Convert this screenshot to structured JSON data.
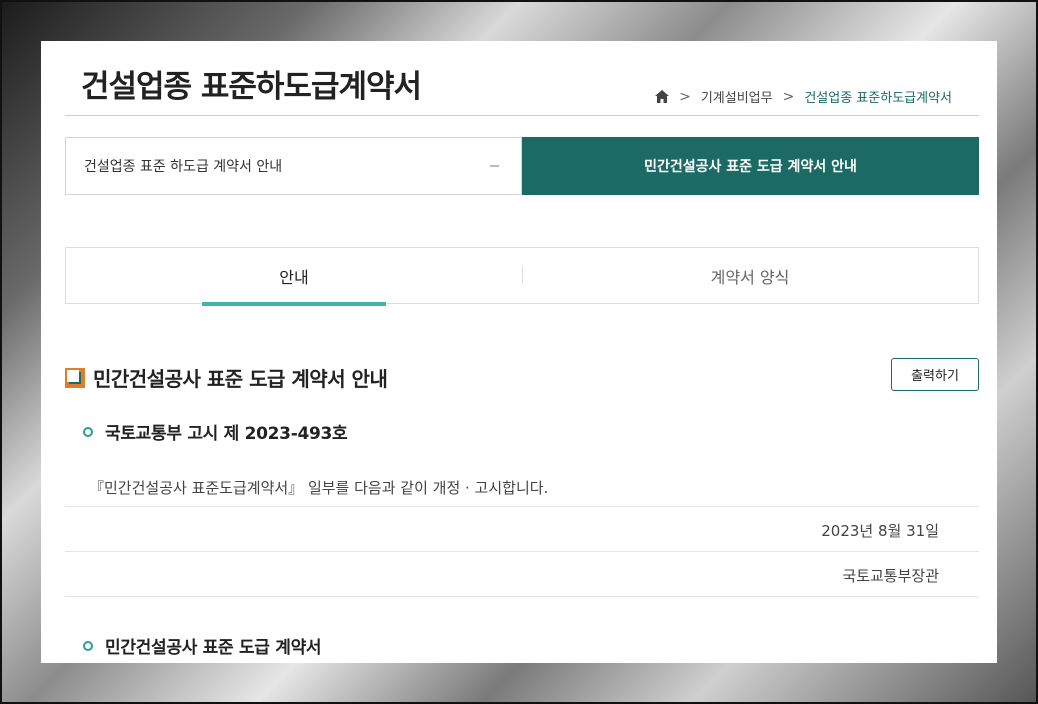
{
  "page": {
    "title": "건설업종 표준하도급계약서"
  },
  "breadcrumb": {
    "home_icon": "home-icon",
    "items": [
      "기계설비업무",
      "건설업종 표준하도급계약서"
    ]
  },
  "selector": {
    "left_label": "건설업종 표준 하도급 계약서 안내",
    "right_label": "민간건설공사 표준 도급 계약서 안내",
    "accent_color": "#1b6b64"
  },
  "tabs": [
    {
      "label": "안내",
      "active": true
    },
    {
      "label": "계약서 양식",
      "active": false
    }
  ],
  "section": {
    "title": "민간건설공사 표준 도급 계약서 안내",
    "print_label": "출력하기"
  },
  "notice": {
    "heading": "국토교통부 고시 제 2023-493호",
    "text": "『민간건설공사 표준도급계약서』 일부를 다음과 같이 개정 · 고시합니다.",
    "date": "2023년 8월 31일",
    "signer": "국토교통부장관"
  },
  "next_section": {
    "heading": "민간건설공사 표준 도급 계약서"
  }
}
